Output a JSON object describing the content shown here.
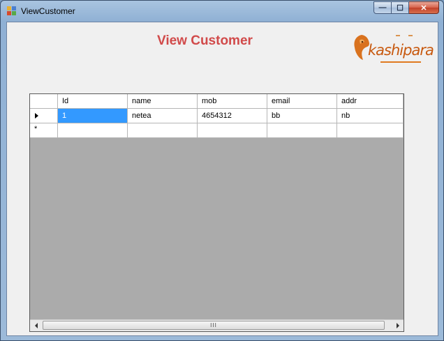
{
  "window": {
    "title": "ViewCustomer",
    "controls": {
      "minimize": "—",
      "maximize": "☐",
      "close": "✕"
    }
  },
  "form": {
    "heading": "View Customer",
    "logo": {
      "text": "kashipara",
      "icon": "lion-logo-icon",
      "brand_color": "#c85a10"
    }
  },
  "grid": {
    "columns": [
      "Id",
      "name",
      "mob",
      "email",
      "addr"
    ],
    "rows": [
      {
        "marker": "current",
        "cells": [
          "1",
          "netea",
          "4654312",
          "bb",
          "nb"
        ]
      },
      {
        "marker": "new",
        "marker_glyph": "*",
        "cells": [
          "",
          "",
          "",
          "",
          ""
        ]
      }
    ],
    "selection_color": "#3399ff",
    "scroll": {
      "thumb_grip": "III"
    }
  }
}
